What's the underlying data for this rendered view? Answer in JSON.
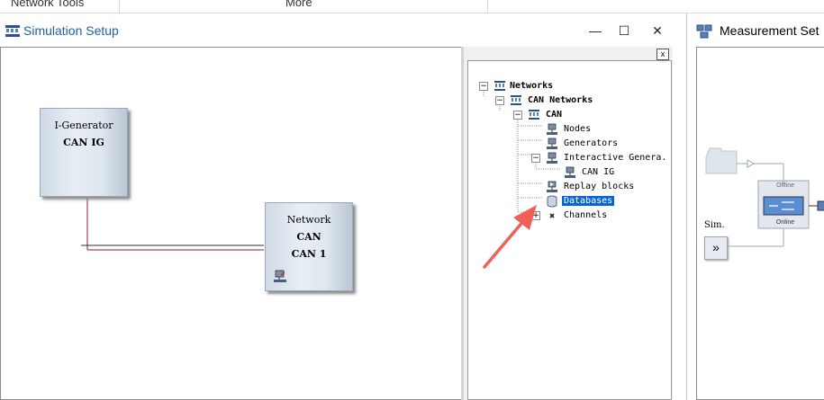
{
  "top_strip": {
    "left_text": "Network Tools",
    "mid_text": "More"
  },
  "simulation_window": {
    "title": "Simulation Setup",
    "minimize_label": "—",
    "maximize_label": "☐",
    "close_label": "✕"
  },
  "blocks": {
    "generator": {
      "line1": "I-Generator",
      "line2": "CAN IG"
    },
    "network": {
      "line1": "Network",
      "line2": "CAN",
      "line3": "CAN 1"
    }
  },
  "tree": {
    "close_label": "x",
    "items": [
      {
        "label": "Networks"
      },
      {
        "label": "CAN Networks"
      },
      {
        "label": "CAN"
      },
      {
        "label": "Nodes"
      },
      {
        "label": "Generators"
      },
      {
        "label": "Interactive Genera."
      },
      {
        "label": "CAN IG"
      },
      {
        "label": "Replay blocks"
      },
      {
        "label": "Databases"
      },
      {
        "label": "Channels"
      }
    ]
  },
  "measurement_window": {
    "title": "Measurement Set",
    "offline_label": "Offline",
    "online_label": "Online",
    "sim_label": "Sim.",
    "sim_button": "»"
  },
  "colors": {
    "title_blue": "#1f5fa8",
    "selection": "#0a64d2",
    "arrow": "#f0605a",
    "wire_red": "#8b1a3a",
    "wire_dark": "#2a2a4a"
  }
}
